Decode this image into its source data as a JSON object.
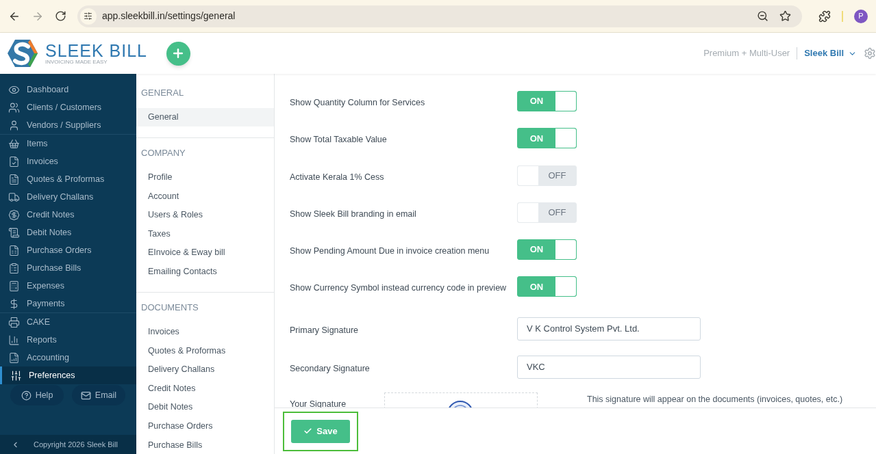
{
  "browser": {
    "url": "app.sleekbill.in/settings/general",
    "profile_initial": "P"
  },
  "header": {
    "brand": "SLEEK BILL",
    "tagline": "INVOICING MADE EASY",
    "plan": "Premium + Multi-User",
    "account": "Sleek Bill"
  },
  "sidebar": {
    "groups": [
      [
        {
          "label": "Dashboard",
          "selected": false
        },
        {
          "label": "Clients / Customers",
          "selected": false
        },
        {
          "label": "Vendors / Suppliers",
          "selected": false
        }
      ],
      [
        {
          "label": "Items",
          "selected": false
        },
        {
          "label": "Invoices",
          "selected": false
        },
        {
          "label": "Quotes & Proformas",
          "selected": false
        },
        {
          "label": "Delivery Challans",
          "selected": false
        },
        {
          "label": "Credit Notes",
          "selected": false
        },
        {
          "label": "Debit Notes",
          "selected": false
        },
        {
          "label": "Purchase Orders",
          "selected": false
        },
        {
          "label": "Purchase Bills",
          "selected": false
        },
        {
          "label": "Expenses",
          "selected": false
        },
        {
          "label": "Payments",
          "selected": false
        }
      ],
      [
        {
          "label": "CAKE",
          "selected": false
        },
        {
          "label": "Reports",
          "selected": false
        },
        {
          "label": "Accounting",
          "selected": false
        },
        {
          "label": "Preferences",
          "selected": true
        }
      ]
    ],
    "help": "Help",
    "email": "Email",
    "copyright": "Copyright 2026 Sleek Bill"
  },
  "settings_nav": [
    {
      "heading": "GENERAL",
      "items": [
        {
          "label": "General",
          "selected": true
        }
      ]
    },
    {
      "heading": "COMPANY",
      "items": [
        {
          "label": "Profile",
          "selected": false
        },
        {
          "label": "Account",
          "selected": false
        },
        {
          "label": "Users & Roles",
          "selected": false
        },
        {
          "label": "Taxes",
          "selected": false
        },
        {
          "label": "EInvoice & Eway bill",
          "selected": false
        },
        {
          "label": "Emailing Contacts",
          "selected": false
        }
      ]
    },
    {
      "heading": "DOCUMENTS",
      "items": [
        {
          "label": "Invoices",
          "selected": false
        },
        {
          "label": "Quotes & Proformas",
          "selected": false
        },
        {
          "label": "Delivery Challans",
          "selected": false
        },
        {
          "label": "Credit Notes",
          "selected": false
        },
        {
          "label": "Debit Notes",
          "selected": false
        },
        {
          "label": "Purchase Orders",
          "selected": false
        },
        {
          "label": "Purchase Bills",
          "selected": false
        }
      ]
    }
  ],
  "toggles": [
    {
      "label": "Show Quantity Column for Services",
      "on": true,
      "text": "ON"
    },
    {
      "label": "Show Total Taxable Value",
      "on": true,
      "text": "ON"
    },
    {
      "label": "Activate Kerala 1% Cess",
      "on": false,
      "text": "OFF"
    },
    {
      "label": "Show Sleek Bill branding in email",
      "on": false,
      "text": "OFF"
    },
    {
      "label": "Show Pending Amount Due in invoice creation menu",
      "on": true,
      "text": "ON"
    },
    {
      "label": "Show Currency Symbol instead currency code in preview",
      "on": true,
      "text": "ON"
    }
  ],
  "fields": [
    {
      "label": "Primary Signature",
      "value": "V K Control System Pvt. Ltd."
    },
    {
      "label": "Secondary Signature",
      "value": "VKC"
    }
  ],
  "signature": {
    "label": "Your Signature",
    "note": "This signature will appear on the documents (invoices, quotes, etc.)"
  },
  "save": "Save"
}
